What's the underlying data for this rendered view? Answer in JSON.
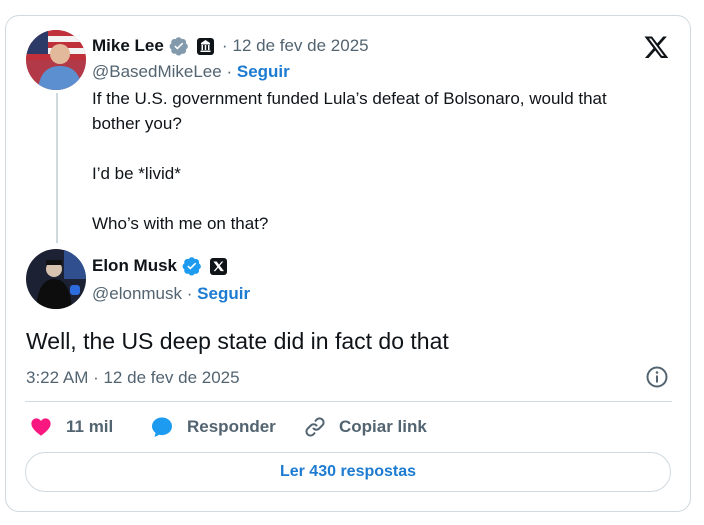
{
  "tweet_parent": {
    "author_name": "Mike Lee",
    "handle": "@BasedMikeLee",
    "separator": "·",
    "date": "12 de fev de 2025",
    "follow": "Seguir",
    "text_line1": "If the U.S. government funded Lula’s defeat of Bolsonaro, would that",
    "text_line2": "bother you?",
    "text_line3": "I’d be *livid*",
    "text_line4": "Who’s with me on that?"
  },
  "tweet_reply": {
    "author_name": "Elon Musk",
    "handle": "@elonmusk",
    "separator": "·",
    "follow": "Seguir",
    "text": "Well, the US deep state did in fact do that",
    "timestamp": "3:22 AM · 12 de fev de 2025"
  },
  "actions": {
    "likes": "11 mil",
    "reply": "Responder",
    "copy": "Copiar link"
  },
  "read_replies": "Ler 430 respostas",
  "icons": [
    "x-logo-icon",
    "verified-icon",
    "government-badge-icon",
    "x-affiliate-icon",
    "info-icon",
    "heart-icon",
    "reply-icon",
    "link-icon"
  ],
  "colors": {
    "accent": "#1d7bd1",
    "like": "#f91880",
    "verified": "#1d9bf0",
    "text": "#0f1419",
    "secondary": "#536471"
  }
}
